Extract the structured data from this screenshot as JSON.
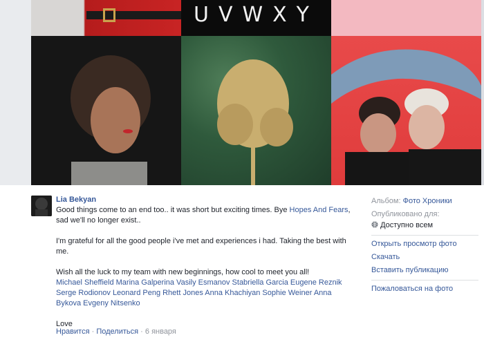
{
  "photo": {
    "letters": "UVWXY"
  },
  "post": {
    "author": "Lia Bekyan",
    "para1_a": "Good things come to an end too.. it was short but exciting times. Bye ",
    "para1_link": "Hopes And Fears",
    "para1_b": ", sad we'll no longer exist..",
    "para2": "I'm grateful for all the good people i've met and experiences i had. Taking the best with me.",
    "para3": "Wish all the luck to my team with new beginnings, how cool to meet you all!",
    "tags": "Michael Sheffield Marina Galperina Vasily Esmanov Stabriella Garcia Eugene Reznik Serge Rodionov Leonard Peng Rhett Jones Anna Khachiyan Sophie Weiner Anna Bykova Evgeny Nitsenko",
    "love": "Love"
  },
  "actions": {
    "like": "Нравится",
    "share": "Поделиться",
    "sep": "·",
    "date": "6 января"
  },
  "sidebar": {
    "album_label": "Альбом:",
    "album_value": "Фото Хроники",
    "published_label": "Опубликовано для:",
    "published_value": "Доступно всем",
    "open_viewer": "Открыть просмотр фото",
    "download": "Скачать",
    "embed": "Вставить публикацию",
    "report": "Пожаловаться на фото"
  }
}
